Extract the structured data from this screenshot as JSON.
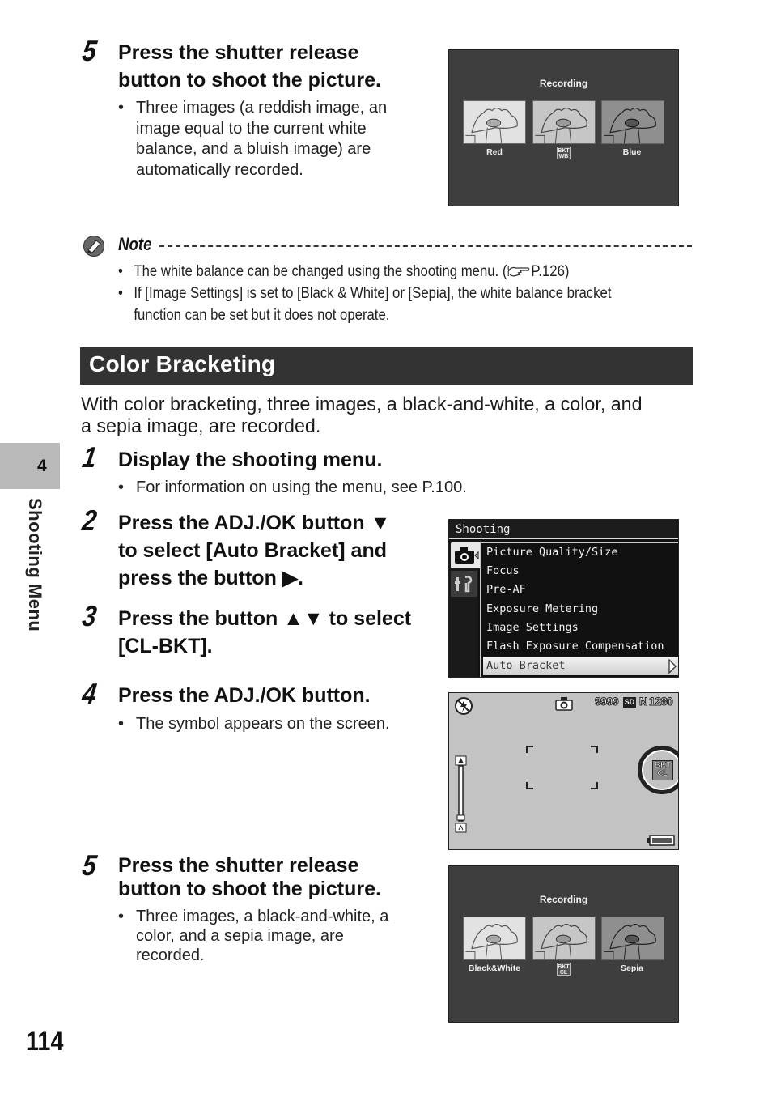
{
  "page": {
    "number": "114",
    "chapter_number": "4",
    "chapter_title": "Shooting Menu"
  },
  "top_step": {
    "number": "5",
    "title_line1": "Press the shutter release",
    "title_line2": "button to shoot the picture.",
    "bullet_lines": [
      "Three images (a reddish image, an",
      "image equal to the current white",
      "balance, and a bluish image) are",
      "automatically recorded."
    ],
    "screen": {
      "title": "Recording",
      "labels": [
        "Red",
        "",
        "Blue"
      ],
      "badge_line1": "BKT",
      "badge_line2": "WB"
    }
  },
  "note": {
    "title": "Note",
    "icon": "note-pencil-icon",
    "bullets": [
      {
        "text": "The white balance can be changed using the shooting menu. (",
        "ref_icon": "pointing-hand-icon",
        "ref": "P.126)"
      },
      {
        "line1": "If [Image Settings] is set to [Black & White] or [Sepia], the white balance bracket",
        "line2": "function can be set but it does not operate."
      }
    ]
  },
  "section": {
    "heading": "Color Bracketing",
    "intro_line1": "With color bracketing, three images, a black-and-white, a color, and",
    "intro_line2": "a sepia image, are recorded."
  },
  "steps": [
    {
      "number": "1",
      "title": "Display the shooting menu.",
      "bullet": "For information on using the menu, see P.100."
    },
    {
      "number": "2",
      "title_lines": [
        "Press the ADJ./OK button ▼",
        "to select [Auto Bracket] and",
        "press the button ▶."
      ]
    },
    {
      "number": "3",
      "title_lines": [
        "Press the button ▲▼ to select",
        "[CL-BKT]."
      ]
    },
    {
      "number": "4",
      "title": "Press the ADJ./OK button.",
      "bullet": "The symbol appears on the screen."
    },
    {
      "number": "5",
      "title_lines": [
        "Press the shutter release",
        "button to shoot the picture."
      ],
      "bullet_lines": [
        "Three images, a black-and-white, a",
        "color, and a sepia image, are",
        "recorded."
      ]
    }
  ],
  "menu_screen": {
    "header": "Shooting",
    "items": [
      "Picture Quality/Size",
      "Focus",
      "Pre-AF",
      "Exposure Metering",
      "Image Settings",
      "Flash Exposure Compensation",
      "Auto Bracket"
    ],
    "selected_index": 6
  },
  "live_screen": {
    "shots_remaining": "9999",
    "card_label": "SD",
    "quality": "N",
    "size": "1280",
    "badge_line1": "BKT",
    "badge_line2": "CL"
  },
  "bottom_screen": {
    "title": "Recording",
    "labels": [
      "Black&White",
      "",
      "Sepia"
    ],
    "badge_line1": "BKT",
    "badge_line2": "CL"
  }
}
